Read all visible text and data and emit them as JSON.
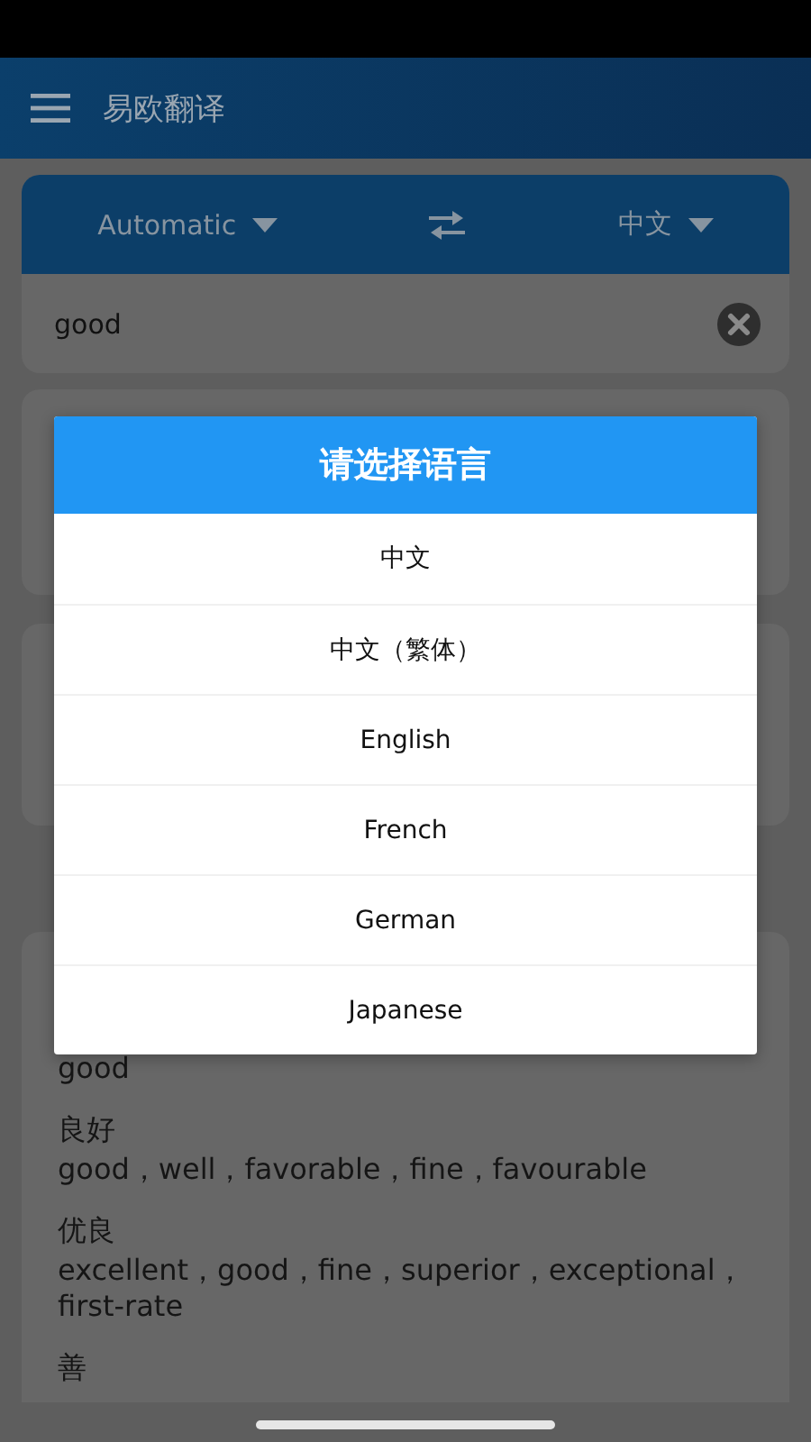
{
  "app_bar": {
    "title": "易欧翻译"
  },
  "language_bar": {
    "source": "Automatic",
    "target": "中文"
  },
  "input": {
    "value": "good"
  },
  "results": {
    "entries": [
      {
        "gloss": "good"
      },
      {
        "term": "良好",
        "gloss": "good，well，favorable，fine，favourable"
      },
      {
        "term": "优良",
        "gloss": "excellent，good，fine，superior，exceptional，first-rate"
      },
      {
        "term": "善"
      }
    ]
  },
  "dialog": {
    "title": "请选择语言",
    "options": [
      {
        "label": "中文",
        "selected": false
      },
      {
        "label": "中文（繁体）",
        "selected": false
      },
      {
        "label": "English",
        "selected": false
      },
      {
        "label": "French",
        "selected": false
      },
      {
        "label": "German",
        "selected": false
      },
      {
        "label": "Japanese",
        "selected": false
      }
    ]
  }
}
